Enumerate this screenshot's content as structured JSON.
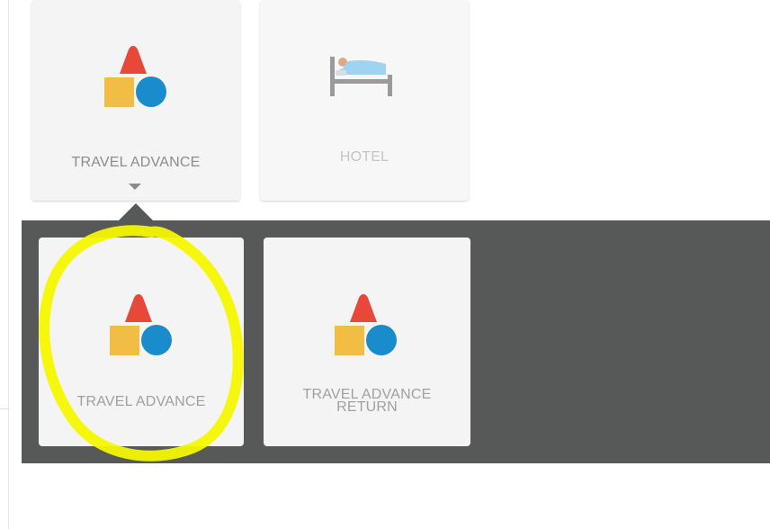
{
  "top_row": {
    "travel_advance": {
      "label": "TRAVEL ADVANCE",
      "icon": "shapes-icon",
      "expanded": true
    },
    "hotel": {
      "label": "HOTEL",
      "icon": "bed-icon"
    }
  },
  "submenu": {
    "items": [
      {
        "label": "TRAVEL ADVANCE",
        "icon": "shapes-icon",
        "highlighted": true
      },
      {
        "label": "TRAVEL ADVANCE RETURN",
        "icon": "shapes-icon"
      }
    ]
  },
  "colors": {
    "panel": "#565958",
    "tile": "#f4f4f4",
    "triangle": "#e8483a",
    "square": "#f2bd45",
    "circle": "#1a8ccc",
    "highlight": "#f4f800"
  }
}
